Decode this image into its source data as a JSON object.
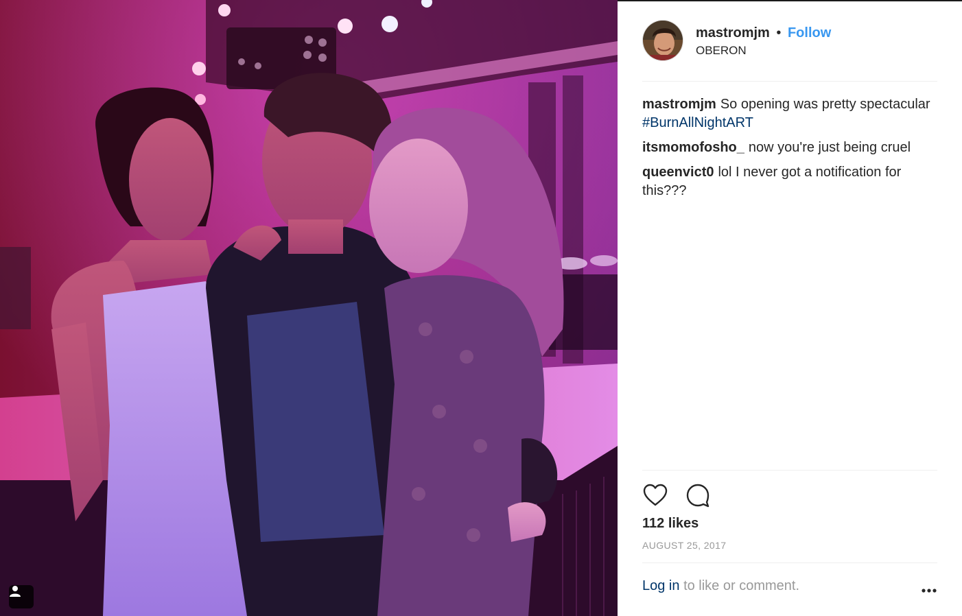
{
  "post": {
    "username": "mastromjm",
    "separator": "•",
    "follow_label": "Follow",
    "location": "OBERON",
    "comments": [
      {
        "user": "mastromjm",
        "text": "So opening was pretty spectacular",
        "hashtag": "#BurnAllNightART"
      },
      {
        "user": "itsmomofosho_",
        "text": "now you're just being cruel"
      },
      {
        "user": "queenvict0",
        "text": "lol I never got a notification for this???"
      }
    ],
    "likes": "112 likes",
    "date": "AUGUST 25, 2017",
    "login_link": "Log in",
    "login_suffix": "to like or comment."
  },
  "icons": {
    "like": "heart-icon",
    "comment": "comment-bubble-icon",
    "more": "more-options-icon",
    "tagged": "tagged-user-icon"
  },
  "colors": {
    "follow": "#3897f0",
    "link": "#003569",
    "muted": "#999999",
    "divider": "#efefef"
  }
}
